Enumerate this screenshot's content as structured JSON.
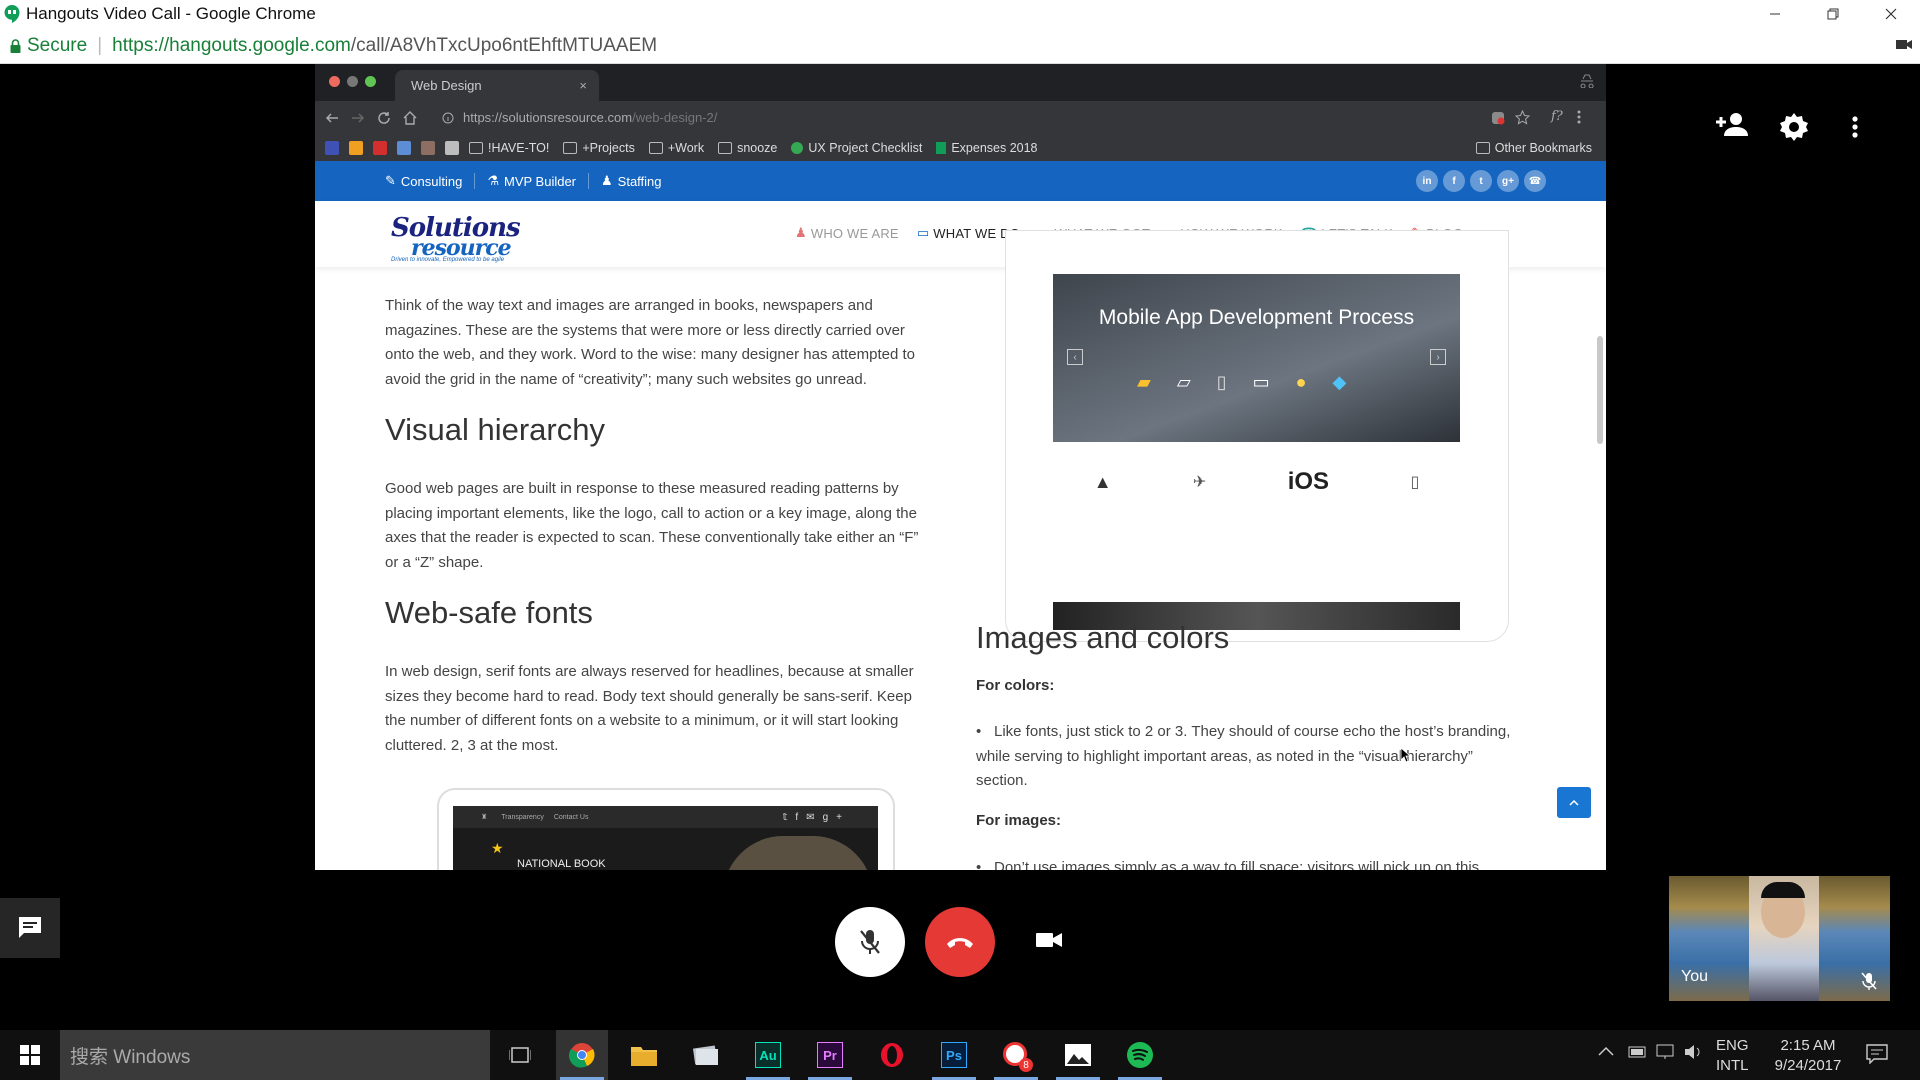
{
  "window": {
    "title": "Hangouts Video Call - Google Chrome",
    "secure_label": "Secure",
    "url_scheme_host": "https://hangouts.google.com",
    "url_path": "/call/A8VhTxcUpo6ntEhftMTUAAEM"
  },
  "shared_browser": {
    "tab_title": "Web Design",
    "tab_close": "×",
    "url_host": "https://solutionsresource.com",
    "url_path": "/web-design-2/",
    "bookmarks": [
      {
        "label": "!HAVE-TO!"
      },
      {
        "label": "+Projects"
      },
      {
        "label": "+Work"
      },
      {
        "label": "snooze"
      },
      {
        "label": "UX Project Checklist"
      },
      {
        "label": "Expenses 2018"
      }
    ],
    "other_bookmarks": "Other Bookmarks"
  },
  "site": {
    "topbar": {
      "items": [
        {
          "label": "Consulting"
        },
        {
          "label": "MVP Builder"
        },
        {
          "label": "Staffing"
        }
      ],
      "social": [
        "in",
        "f",
        "t",
        "g+",
        "☎"
      ]
    },
    "logo": {
      "line1": "Solutions",
      "line2": "resource",
      "tagline": "Driven to innovate, Empowered to be agile"
    },
    "nav": [
      {
        "label": "WHO WE ARE",
        "color": "#e57373"
      },
      {
        "label": "WHAT WE DO",
        "color": "#1565c0"
      },
      {
        "label": "WHAT WE GOT",
        "color": "#ab47bc"
      },
      {
        "label": "HOW WE WORK",
        "color": "#fbc02d"
      },
      {
        "label": "LET'S TALK",
        "color": "#26a69a"
      },
      {
        "label": "BLOG",
        "color": "#e53935"
      }
    ],
    "left": {
      "para1": "Think of the way text and images are arranged in books, newspapers and magazines. These are the systems that were more or less directly carried over onto the web, and they work. Word to the wise: many designer has attempted to avoid the grid in the name of “creativity”; many such websites go unread.",
      "h_visual": "Visual hierarchy",
      "para2": "Good web pages are built in response to these measured reading patterns by placing important elements, like the logo, call to action or a key image, along the axes that the reader is expected to scan. These conventionally take either an “F” or a “Z” shape.",
      "h_fonts": "Web-safe fonts",
      "para3": "In web design, serif fonts are always reserved for headlines, because at smaller sizes they become hard to read. Body text should generally be sans-serif. Keep the number of different fonts on a website to a minimum, or it will start looking cluttered. 2, 3 at the most.",
      "thumb_links": [
        "Transparency",
        "Contact Us"
      ],
      "thumb_heading": "NATIONAL BOOK"
    },
    "right": {
      "mockup_title": "Mobile App Development Process",
      "mockup_ios": "iOS",
      "h_images": "Images and colors",
      "for_colors": "For colors:",
      "colors_bullet": "Like fonts, just stick to 2 or 3. They should of course echo the host’s branding, while serving to highlight important areas, as noted in the “visual hierarchy” section.",
      "for_images": "For images:",
      "images_bullet": "Don’t use images simply as a way to fill space; visitors will pick up on this"
    }
  },
  "call": {
    "self_label": "You"
  },
  "taskbar": {
    "search_placeholder": "搜索 Windows",
    "lang1": "ENG",
    "lang2": "INTL",
    "time": "2:15 AM",
    "date": "9/24/2017",
    "badge": "8"
  },
  "colors": {
    "hangouts_green": "#0f9d58",
    "site_blue": "#1565c0",
    "end_call_red": "#e53935"
  }
}
